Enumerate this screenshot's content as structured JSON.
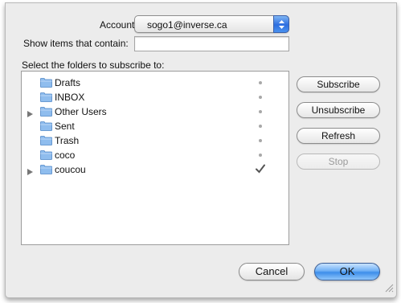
{
  "dialog": {
    "account_label": "Account:",
    "account_value": "sogo1@inverse.ca",
    "filter_label": "Show items that contain:",
    "filter_value": "",
    "folders_label": "Select the folders to subscribe to:"
  },
  "folders": [
    {
      "name": "Drafts",
      "expandable": false,
      "subscribed": false
    },
    {
      "name": "INBOX",
      "expandable": false,
      "subscribed": false
    },
    {
      "name": "Other Users",
      "expandable": true,
      "subscribed": false
    },
    {
      "name": "Sent",
      "expandable": false,
      "subscribed": false
    },
    {
      "name": "Trash",
      "expandable": false,
      "subscribed": false
    },
    {
      "name": "coco",
      "expandable": false,
      "subscribed": false
    },
    {
      "name": "coucou",
      "expandable": true,
      "subscribed": true
    }
  ],
  "buttons": {
    "subscribe": "Subscribe",
    "unsubscribe": "Unsubscribe",
    "refresh": "Refresh",
    "stop": "Stop",
    "cancel": "Cancel",
    "ok": "OK"
  },
  "icons": {
    "folder": "folder-icon",
    "disclosure": "disclosure-triangle-icon",
    "popup": "popup-arrows-icon",
    "check": "checkmark-icon",
    "resize": "resize-grip-icon"
  },
  "colors": {
    "window_bg": "#ececec",
    "accent": "#3d8eea",
    "folder_blue": "#7fb0e6"
  }
}
